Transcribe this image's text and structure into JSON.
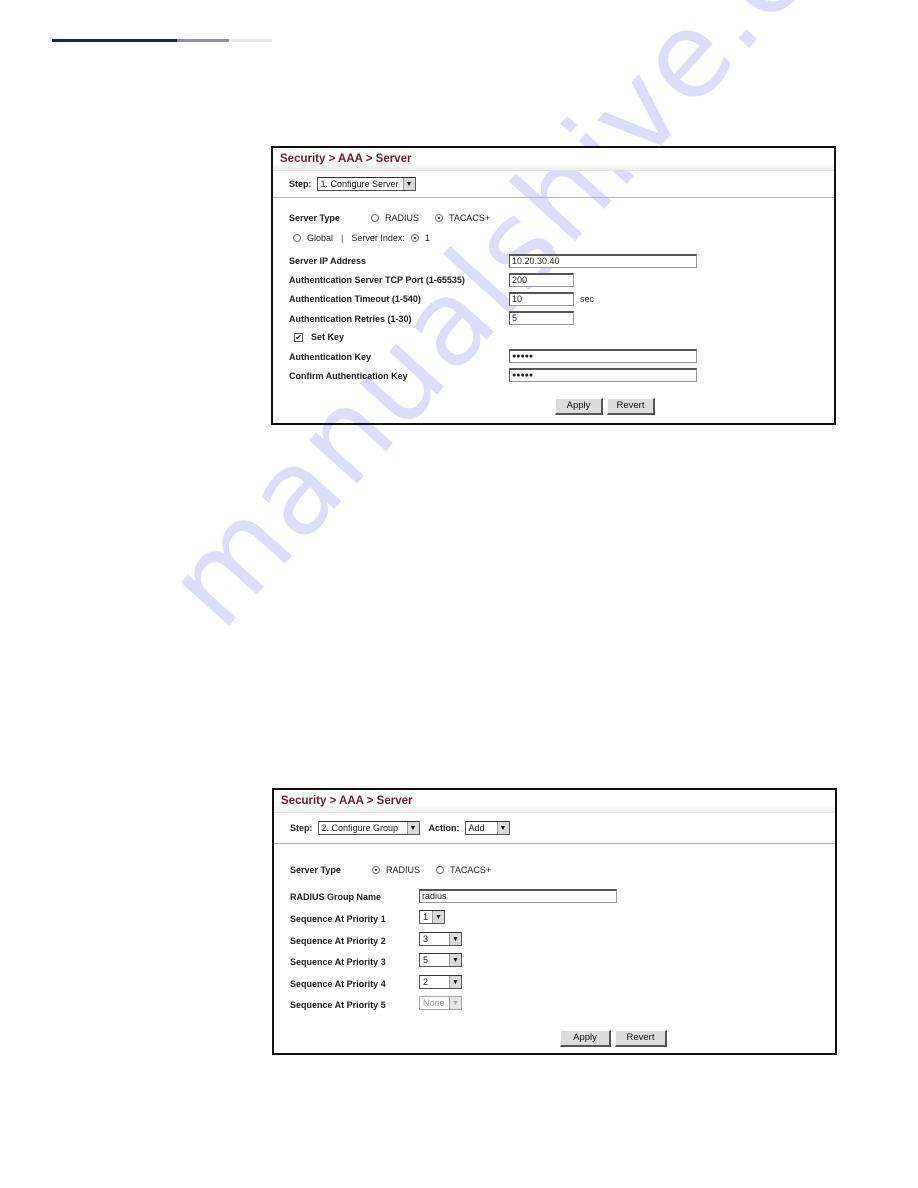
{
  "page": {
    "watermark": "manualshive.com"
  },
  "panel1": {
    "title": "Security > AAA > Server",
    "step_label": "Step:",
    "step_value": "1. Configure Server",
    "server_type_label": "Server Type",
    "server_type_options": [
      {
        "label": "RADIUS",
        "selected": false
      },
      {
        "label": "TACACS+",
        "selected": true
      }
    ],
    "scope_global_label": "Global",
    "scope_separator": "|",
    "server_index_label": "Server Index:",
    "server_index_value": "1",
    "fields": {
      "server_ip": {
        "label": "Server IP Address",
        "value": "10.20.30.40"
      },
      "tcp_port": {
        "label": "Authentication Server TCP Port (1-65535)",
        "value": "200"
      },
      "timeout": {
        "label": "Authentication Timeout (1-540)",
        "value": "10",
        "unit": "sec"
      },
      "retries": {
        "label": "Authentication Retries (1-30)",
        "value": "5"
      },
      "set_key": {
        "label": "Set Key",
        "checked": true
      },
      "auth_key": {
        "label": "Authentication Key",
        "value": "●●●●●"
      },
      "confirm_key": {
        "label": "Confirm Authentication Key",
        "value": "●●●●●"
      }
    },
    "apply_label": "Apply",
    "revert_label": "Revert"
  },
  "panel2": {
    "title": "Security > AAA > Server",
    "step_label": "Step:",
    "step_value": "2. Configure Group",
    "action_label": "Action:",
    "action_value": "Add",
    "server_type_label": "Server Type",
    "server_type_options": [
      {
        "label": "RADIUS",
        "selected": true
      },
      {
        "label": "TACACS+",
        "selected": false
      }
    ],
    "group_name_label": "RADIUS Group Name",
    "group_name_value": "radius",
    "priorities": [
      {
        "label": "Sequence At Priority 1",
        "value": "1",
        "enabled": true
      },
      {
        "label": "Sequence At Priority 2",
        "value": "3",
        "enabled": true
      },
      {
        "label": "Sequence At Priority 3",
        "value": "5",
        "enabled": true
      },
      {
        "label": "Sequence At Priority 4",
        "value": "2",
        "enabled": true
      },
      {
        "label": "Sequence At Priority 5",
        "value": "None",
        "enabled": false
      }
    ],
    "apply_label": "Apply",
    "revert_label": "Revert"
  },
  "icons": {
    "dropdown_arrow": "▼",
    "checkmark": "✔"
  }
}
